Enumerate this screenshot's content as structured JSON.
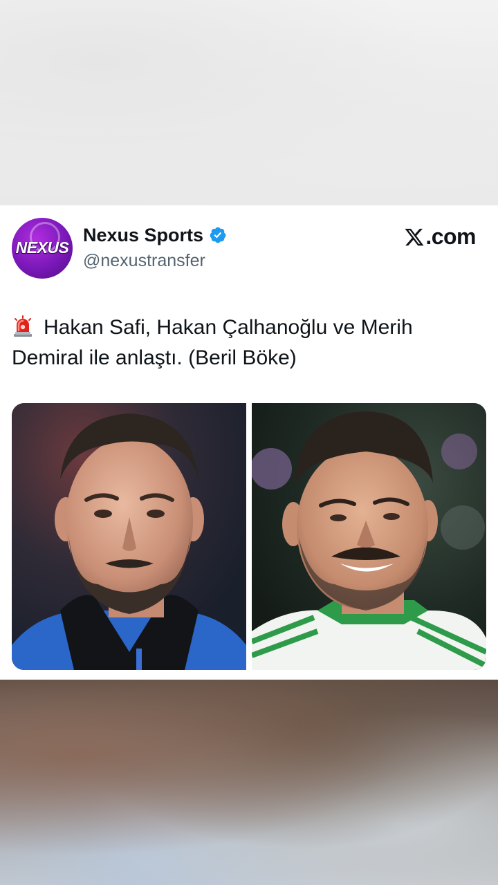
{
  "post": {
    "display_name": "Nexus Sports",
    "handle": "@nexustransfer",
    "avatar_logo_text": "NEXUS",
    "site_label": ".com",
    "site_logo_icon": "x-logo-icon",
    "verified_icon": "verified-badge-icon",
    "siren_icon": "police-siren-icon",
    "text": "Hakan Safi, Hakan Çalhanoğlu ve Merih Demiral ile anlaştı. (Beril Böke)"
  },
  "media": {
    "photos": [
      {
        "description": "player-photo-left"
      },
      {
        "description": "player-photo-right"
      }
    ]
  },
  "colors": {
    "verified": "#1d9bf0",
    "avatar": "#8a1fc8",
    "text": "#0f1419",
    "handle": "#536471"
  }
}
